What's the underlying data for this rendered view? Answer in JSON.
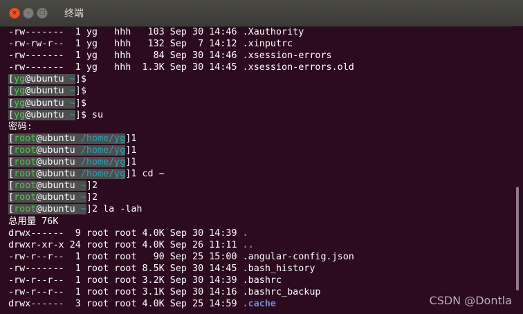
{
  "window": {
    "title": "终端",
    "close_glyph": "×",
    "min_glyph": "–",
    "max_glyph": "□"
  },
  "terminal": {
    "lines": [
      "-rw-------  1 yg   hhh   103 Sep 30 14:46 .Xauthority",
      "-rw-rw-r--  1 yg   hhh   132 Sep  7 14:12 .xinputrc",
      "-rw-------  1 yg   hhh    84 Sep 30 14:46 .xsession-errors",
      "-rw-------  1 yg   hhh  1.3K Sep 30 14:45 .xsession-errors.old"
    ],
    "yg_prompts": [
      {
        "bo": "[",
        "user": "yg",
        "at": "@ubuntu ",
        "dir": "~",
        "bc": "]",
        "cmd": "$"
      },
      {
        "bo": "[",
        "user": "yg",
        "at": "@ubuntu ",
        "dir": "~",
        "bc": "]",
        "cmd": "$"
      },
      {
        "bo": "[",
        "user": "yg",
        "at": "@ubuntu ",
        "dir": "~",
        "bc": "]",
        "cmd": "$"
      },
      {
        "bo": "[",
        "user": "yg",
        "at": "@ubuntu ",
        "dir": "~",
        "bc": "]",
        "cmd": "$ su"
      }
    ],
    "password_prompt": "密码:",
    "root_prompts_home": [
      {
        "bo": "[",
        "user": "root",
        "at": "@ubuntu ",
        "dir": "/home/yg",
        "bc": "]",
        "cmd": "1"
      },
      {
        "bo": "[",
        "user": "root",
        "at": "@ubuntu ",
        "dir": "/home/yg",
        "bc": "]",
        "cmd": "1"
      },
      {
        "bo": "[",
        "user": "root",
        "at": "@ubuntu ",
        "dir": "/home/yg",
        "bc": "]",
        "cmd": "1"
      },
      {
        "bo": "[",
        "user": "root",
        "at": "@ubuntu ",
        "dir": "/home/yg",
        "bc": "]",
        "cmd": "1 cd ~"
      }
    ],
    "root_prompts_tilde": [
      {
        "bo": "[",
        "user": "root",
        "at": "@ubuntu ",
        "dir": "~",
        "bc": "]",
        "cmd": "2"
      },
      {
        "bo": "[",
        "user": "root",
        "at": "@ubuntu ",
        "dir": "~",
        "bc": "]",
        "cmd": "2"
      },
      {
        "bo": "[",
        "user": "root",
        "at": "@ubuntu ",
        "dir": "~",
        "bc": "]",
        "cmd": "2 la -lah"
      }
    ],
    "total_line": "总用量 76K",
    "listing": [
      {
        "meta": "drwx------  9 root root 4.0K Sep 30 14:39 ",
        "name": ".",
        "isdir": true
      },
      {
        "meta": "drwxr-xr-x 24 root root 4.0K Sep 26 11:11 ",
        "name": "..",
        "isdir": true
      },
      {
        "meta": "-rw-r--r--  1 root root   90 Sep 25 15:00 ",
        "name": ".angular-config.json",
        "isdir": false
      },
      {
        "meta": "-rw-------  1 root root 8.5K Sep 30 14:45 ",
        "name": ".bash_history",
        "isdir": false
      },
      {
        "meta": "-rw-r--r--  1 root root 3.2K Sep 30 14:39 ",
        "name": ".bashrc",
        "isdir": false
      },
      {
        "meta": "-rw-r--r--  1 root root 3.1K Sep 30 14:16 ",
        "name": ".bashrc_backup",
        "isdir": false
      },
      {
        "meta": "drwx------  3 root root 4.0K Sep 25 14:59 ",
        "name": ".cache",
        "isdir": true
      }
    ]
  },
  "watermark": "CSDN @Dontla"
}
